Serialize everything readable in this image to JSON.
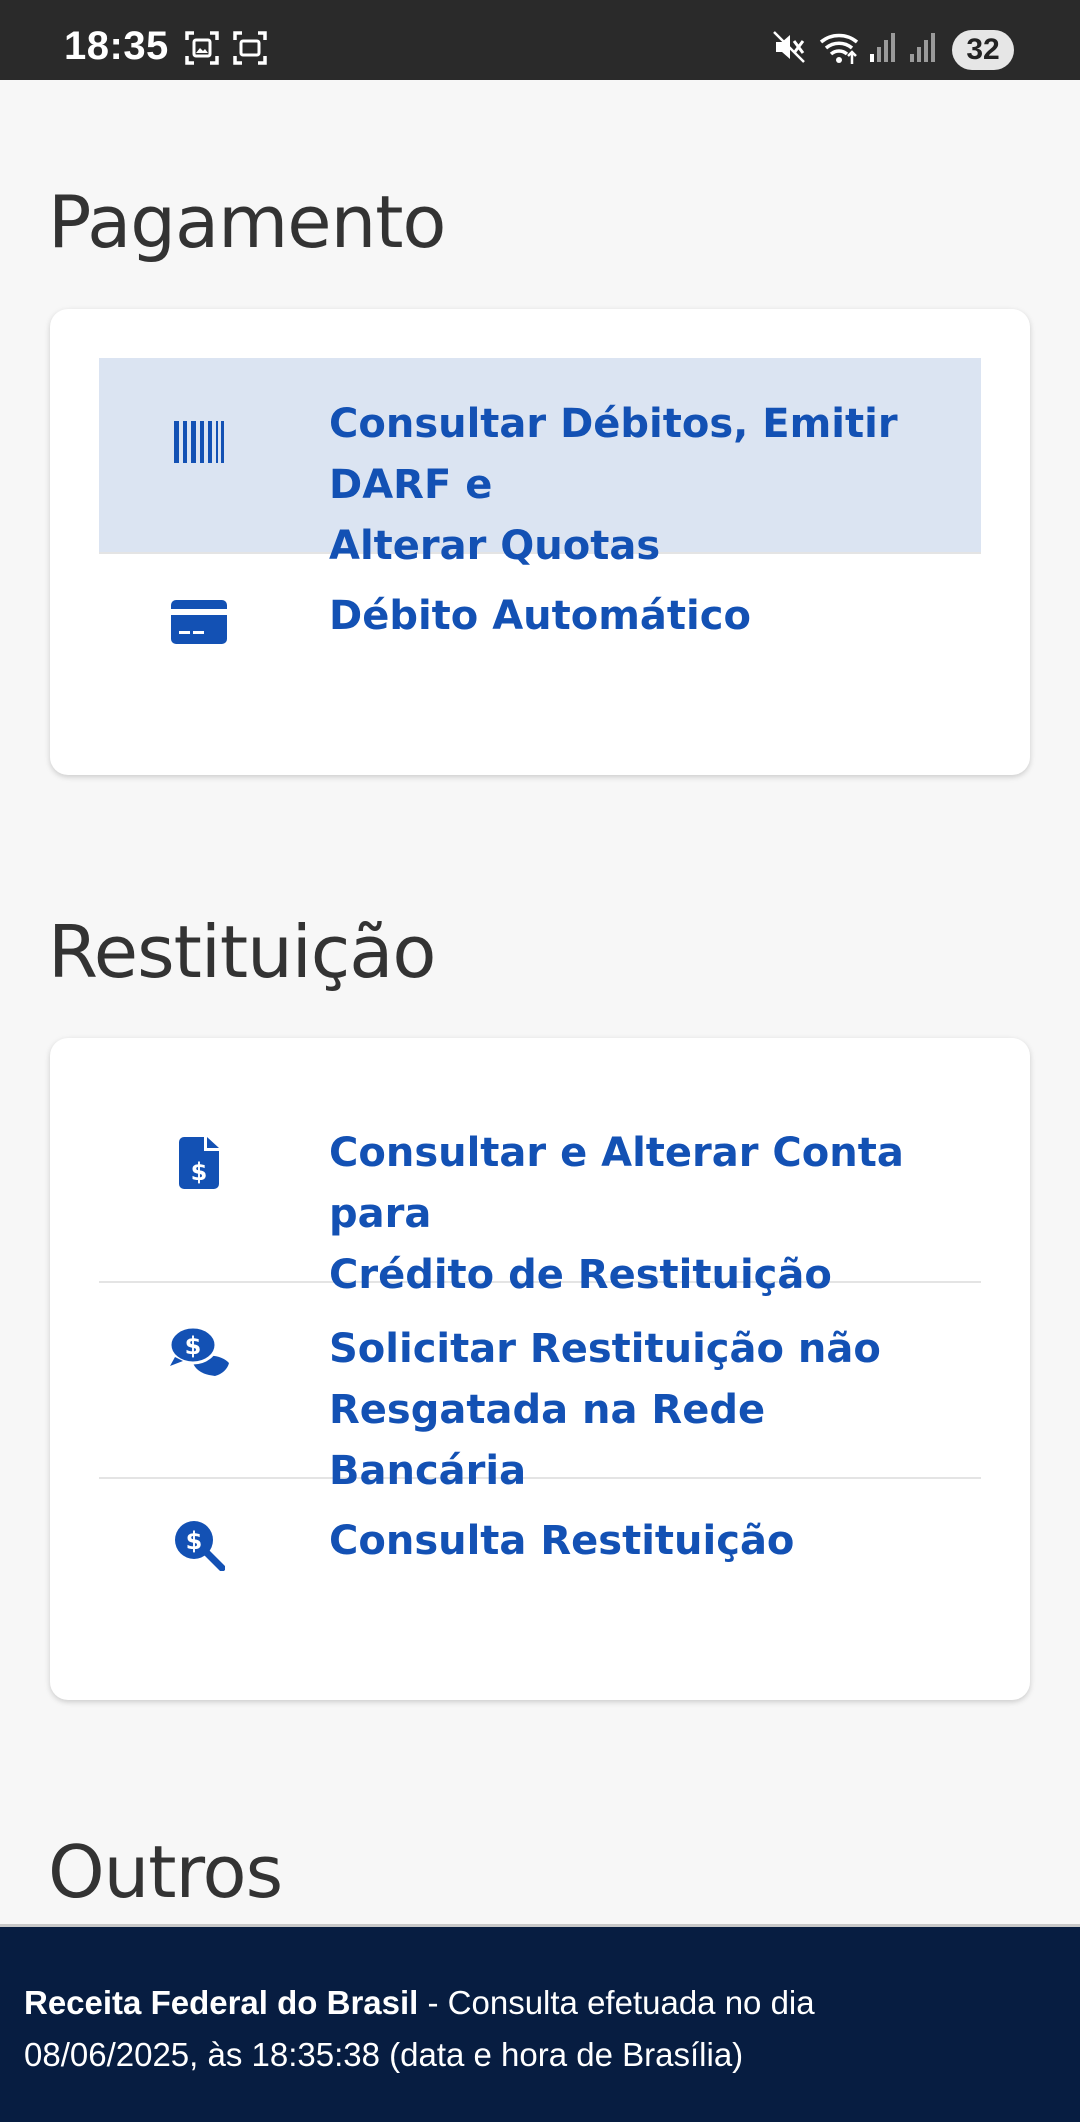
{
  "status_bar": {
    "time": "18:35",
    "battery": "32",
    "icons": [
      "screenshot-icon",
      "screen-record-icon",
      "mute-icon",
      "wifi-icon",
      "signal-icon",
      "signal-icon"
    ]
  },
  "sections": {
    "pagamento": {
      "title": "Pagamento",
      "items": [
        {
          "label_line1": "Consultar Débitos, Emitir DARF e",
          "label_line2": "Alterar Quotas",
          "icon": "barcode-icon"
        },
        {
          "label": "Débito Automático",
          "icon": "credit-card-icon"
        }
      ]
    },
    "restituicao": {
      "title": "Restituição",
      "items": [
        {
          "label_line1": "Consultar e Alterar Conta para",
          "label_line2": "Crédito de Restituição",
          "icon": "file-invoice-dollar-icon"
        },
        {
          "label_line1": "Solicitar Restituição não",
          "label_line2": "Resgatada na Rede Bancária",
          "icon": "comments-dollar-icon"
        },
        {
          "label": "Consulta Restituição",
          "icon": "search-dollar-icon"
        }
      ]
    },
    "outros": {
      "title": "Outros"
    }
  },
  "footer": {
    "org": "Receita Federal do Brasil",
    "text_line1": " - Consulta efetuada no dia",
    "text_line2": "08/06/2025, às 18:35:38 (data e hora de Brasília)"
  },
  "colors": {
    "link": "#1351b4",
    "highlight": "#dbe4f2",
    "footer_bg": "#071d41",
    "status_bg": "#2a2a2a"
  }
}
